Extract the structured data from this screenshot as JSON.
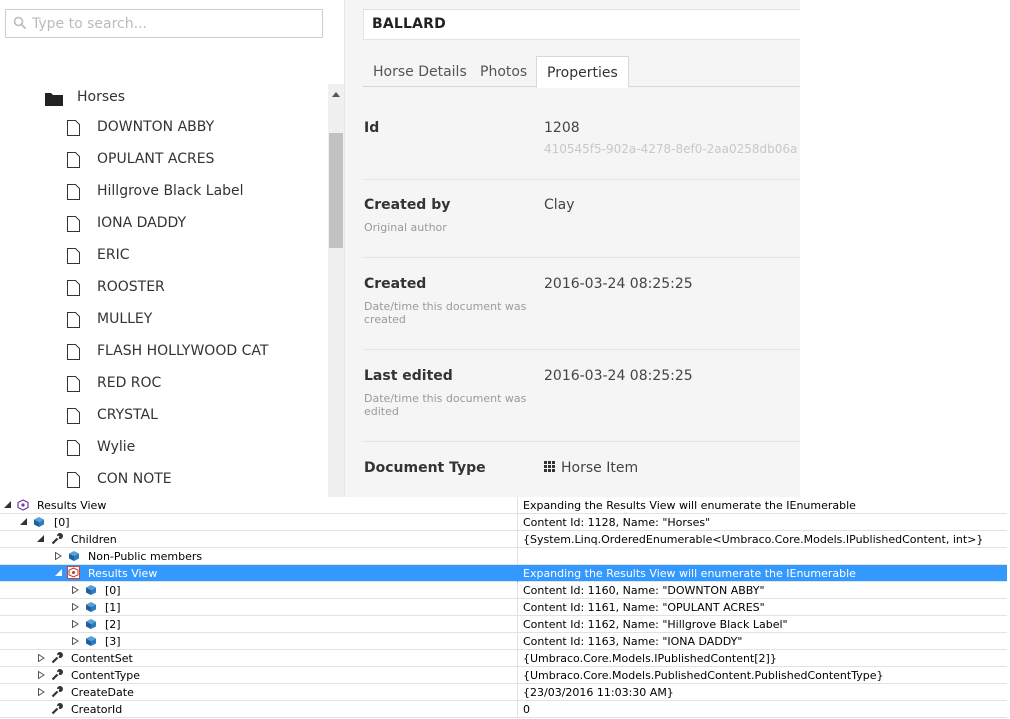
{
  "search": {
    "placeholder": "Type to search..."
  },
  "tree": {
    "root_label": "Horses",
    "items": [
      "DOWNTON ABBY",
      "OPULANT ACRES",
      "Hillgrove Black Label",
      "IONA DADDY",
      "ERIC",
      "ROOSTER",
      "MULLEY",
      "FLASH HOLLYWOOD CAT",
      "RED ROC",
      "CRYSTAL",
      "Wylie",
      "CON NOTE"
    ]
  },
  "editor": {
    "name": "BALLARD",
    "tabs": [
      "Horse Details",
      "Photos",
      "Properties"
    ],
    "active_tab": "Properties",
    "properties": {
      "id": {
        "label": "Id",
        "value": "1208",
        "guid": "410545f5-902a-4278-8ef0-2aa0258db06a"
      },
      "created_by": {
        "label": "Created by",
        "desc": "Original author",
        "value": "Clay"
      },
      "created": {
        "label": "Created",
        "desc": "Date/time this document was created",
        "value": "2016-03-24 08:25:25"
      },
      "last_edited": {
        "label": "Last edited",
        "desc": "Date/time this document was edited",
        "value": "2016-03-24 08:25:25"
      },
      "document_type": {
        "label": "Document Type",
        "value": "Horse Item"
      }
    }
  },
  "watch": {
    "rows": [
      {
        "name": "Results View",
        "value": "Expanding the Results View will enumerate the IEnumerable"
      },
      {
        "name": "[0]",
        "value": "Content Id: 1128, Name: \"Horses\""
      },
      {
        "name": "Children",
        "value": "{System.Linq.OrderedEnumerable<Umbraco.Core.Models.IPublishedContent, int>}"
      },
      {
        "name": "Non-Public members",
        "value": ""
      },
      {
        "name": "Results View",
        "value": "Expanding the Results View will enumerate the IEnumerable"
      },
      {
        "name": "[0]",
        "value": "Content Id: 1160, Name: \"DOWNTON ABBY\""
      },
      {
        "name": "[1]",
        "value": "Content Id: 1161, Name: \"OPULANT ACRES\""
      },
      {
        "name": "[2]",
        "value": "Content Id: 1162, Name: \"Hillgrove Black Label\""
      },
      {
        "name": "[3]",
        "value": "Content Id: 1163, Name: \"IONA DADDY\""
      },
      {
        "name": "ContentSet",
        "value": "{Umbraco.Core.Models.IPublishedContent[2]}"
      },
      {
        "name": "ContentType",
        "value": "{Umbraco.Core.Models.PublishedContent.PublishedContentType}"
      },
      {
        "name": "CreateDate",
        "value": "{23/03/2016 11:03:30 AM}"
      },
      {
        "name": "CreatorId",
        "value": "0"
      }
    ]
  },
  "colors": {
    "selection": "#3399ff",
    "editor_bg": "#f5f5f5"
  }
}
